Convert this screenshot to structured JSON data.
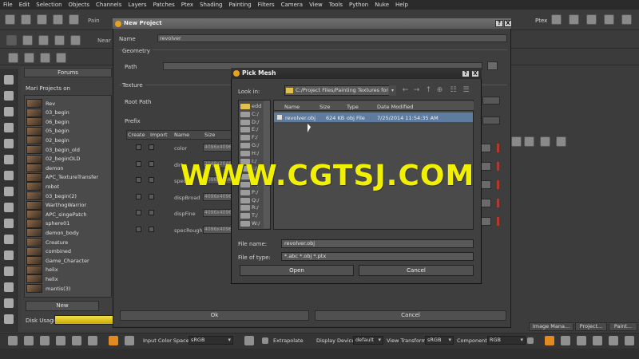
{
  "menubar": {
    "items": [
      "File",
      "Edit",
      "Selection",
      "Objects",
      "Channels",
      "Layers",
      "Patches",
      "Ptex",
      "Shading",
      "Painting",
      "Filters",
      "Camera",
      "View",
      "Tools",
      "Python",
      "Nuke",
      "Help"
    ]
  },
  "toolbar": {
    "paint_label": "Pain",
    "near_label": "Near",
    "ptex_label": "Ptex"
  },
  "projects_panel": {
    "forums_tab": "Forums",
    "title": "Mari Projects on",
    "projects": [
      "Rev",
      "03_begin",
      "06_begin",
      "05_begin",
      "02_begin",
      "03_begin_old",
      "02_beginOLD",
      "demon",
      "APC_TextureTransfer",
      "robot",
      "03_begin(2)",
      "WarthogWarrior",
      "APC_singePatch",
      "sphere01",
      "demon_body",
      "Creature",
      "combined",
      "Game_Character",
      "helix",
      "helix",
      "mantis(3)"
    ],
    "new_button": "New",
    "disk_usage_label": "Disk Usage"
  },
  "new_project": {
    "title": "New Project",
    "help_btn": "?",
    "close_btn": "X",
    "name_label": "Name",
    "name_value": "revolver",
    "geometry_label": "Geometry",
    "path_label": "Path",
    "texture_label": "Texture",
    "root_path_label": "Root Path",
    "prefix_label": "Prefix",
    "table_headers": [
      "Create",
      "Import",
      "Name",
      "Size"
    ],
    "channels": [
      {
        "name": "color",
        "size": "4096x4096"
      },
      {
        "name": "dirt",
        "size": "2048x2048"
      },
      {
        "name": "spec",
        "size": "4096x4096"
      },
      {
        "name": "dispBroad",
        "size": "4096x4096"
      },
      {
        "name": "dispFine",
        "size": "4096x4096"
      },
      {
        "name": "specRough",
        "size": "4096x4096"
      }
    ],
    "ok_button": "Ok",
    "cancel_button": "Cancel"
  },
  "pick_mesh": {
    "title": "Pick Mesh",
    "help_btn": "?",
    "close_btn": "X",
    "look_in_label": "Look in:",
    "look_in_value": "C:/Project Files/Painting Textures for L",
    "places": [
      "edd",
      "C:/",
      "D:/",
      "E:/",
      "F:/",
      "G:/",
      "H:/",
      "I:/",
      "J:/",
      "K:/",
      "O:/",
      "P:/",
      "Q:/",
      "R:/",
      "T:/",
      "W:/"
    ],
    "columns": [
      "Name",
      "Size",
      "Type",
      "Date Modified"
    ],
    "files": [
      {
        "name": "revolver.obj",
        "size": "624 KB",
        "type": "obj File",
        "date": "7/25/2014 11:54:35 AM"
      }
    ],
    "file_name_label": "File name:",
    "file_name_value": "revolver.obj",
    "file_type_label": "File of type:",
    "file_type_value": "*.abc *.obj *.ptx",
    "open_button": "Open",
    "cancel_button": "Cancel"
  },
  "right_panel": {
    "tabs": [
      "Image Mana...",
      "Project...",
      "Paint..."
    ]
  },
  "bottombar": {
    "input_color_space_label": "Input Color Space",
    "input_color_space_value": "sRGB",
    "extrapolate_label": "Extrapolate",
    "display_device_label": "Display Device",
    "display_device_value": "default",
    "view_transform_label": "View Transform",
    "view_transform_value": "sRGB",
    "component_label": "Component",
    "component_value": "RGB"
  },
  "watermark": "WWW.CGTSJ.COM",
  "colors": {
    "selection": "#5d7ca0",
    "disk_bar": "#e6cf2a",
    "watermark": "#f0f000"
  }
}
